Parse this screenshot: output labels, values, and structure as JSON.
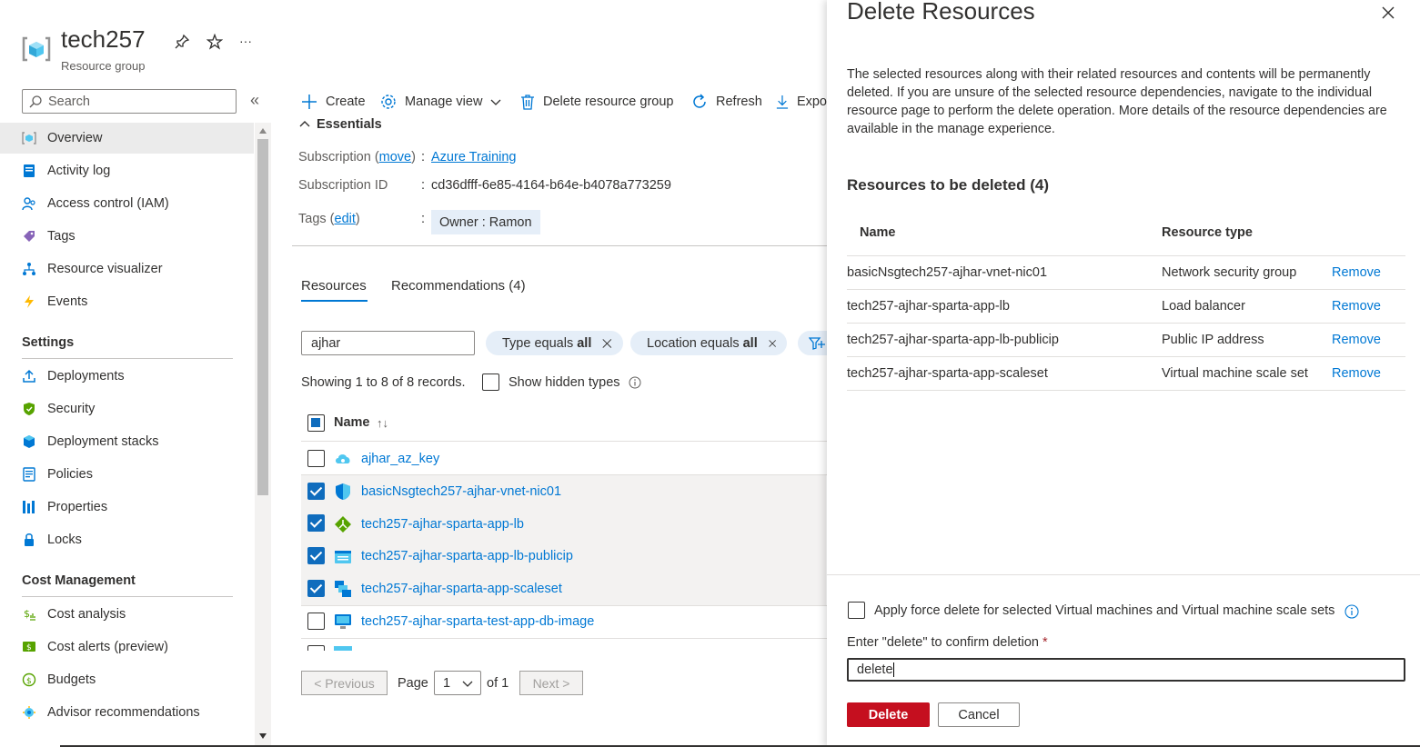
{
  "header": {
    "title": "tech257",
    "subtitle": "Resource group",
    "more": "···"
  },
  "search": {
    "placeholder": "Search",
    "collapse": "«"
  },
  "sidebar": {
    "items": [
      {
        "label": "Overview"
      },
      {
        "label": "Activity log"
      },
      {
        "label": "Access control (IAM)"
      },
      {
        "label": "Tags"
      },
      {
        "label": "Resource visualizer"
      },
      {
        "label": "Events"
      }
    ],
    "settings_title": "Settings",
    "settings": [
      {
        "label": "Deployments"
      },
      {
        "label": "Security"
      },
      {
        "label": "Deployment stacks"
      },
      {
        "label": "Policies"
      },
      {
        "label": "Properties"
      },
      {
        "label": "Locks"
      }
    ],
    "cost_title": "Cost Management",
    "cost": [
      {
        "label": "Cost analysis"
      },
      {
        "label": "Cost alerts (preview)"
      },
      {
        "label": "Budgets"
      },
      {
        "label": "Advisor recommendations"
      }
    ]
  },
  "toolbar": {
    "create": "Create",
    "manage_view": "Manage view",
    "delete_group": "Delete resource group",
    "refresh": "Refresh",
    "export": "Expo"
  },
  "essentials": {
    "title": "Essentials",
    "subscription_label": "Subscription (",
    "move": "move",
    "subscription_label_end": ")",
    "colon": ":",
    "subscription_value": "Azure Training",
    "subscription_id_label": "Subscription ID",
    "subscription_id_value": "cd36dfff-6e85-4164-b64e-b4078a773259",
    "tags_label": "Tags (",
    "edit": "edit",
    "tags_label_end": ")",
    "tag_value": "Owner : Ramon"
  },
  "tabs": {
    "resources": "Resources",
    "recommendations": "Recommendations (4)"
  },
  "filter": {
    "value": "ajhar",
    "type_pill": "Type equals ",
    "type_bold": "all",
    "location_pill": "Location equals ",
    "location_bold": "all"
  },
  "records": {
    "showing": "Showing 1 to 8 of 8 records.",
    "show_hidden": "Show hidden types"
  },
  "table": {
    "name_header": "Name",
    "sort_glyph": "↑↓",
    "rows": [
      {
        "name": "ajhar_az_key",
        "checked": false
      },
      {
        "name": "basicNsgtech257-ajhar-vnet-nic01",
        "checked": true
      },
      {
        "name": "tech257-ajhar-sparta-app-lb",
        "checked": true
      },
      {
        "name": "tech257-ajhar-sparta-app-lb-publicip",
        "checked": true
      },
      {
        "name": "tech257-ajhar-sparta-app-scaleset",
        "checked": true
      },
      {
        "name": "tech257-ajhar-sparta-test-app-db-image",
        "checked": false
      }
    ]
  },
  "pagination": {
    "previous": "< Previous",
    "page": "Page",
    "page_value": "1",
    "of": "of 1",
    "next": "Next >"
  },
  "panel": {
    "title": "Delete Resources",
    "close": "✕",
    "description": "The selected resources along with their related resources and contents will be permanently deleted. If you are unsure of the selected resource dependencies, navigate to the individual resource page to perform the delete operation. More details of the resource dependencies are available in the manage experience.",
    "list_title": "Resources to be deleted (4)",
    "col_name": "Name",
    "col_type": "Resource type",
    "rows": [
      {
        "name": "basicNsgtech257-ajhar-vnet-nic01",
        "type": "Network security group",
        "action": "Remove"
      },
      {
        "name": "tech257-ajhar-sparta-app-lb",
        "type": "Load balancer",
        "action": "Remove"
      },
      {
        "name": "tech257-ajhar-sparta-app-lb-publicip",
        "type": "Public IP address",
        "action": "Remove"
      },
      {
        "name": "tech257-ajhar-sparta-app-scaleset",
        "type": "Virtual machine scale set",
        "action": "Remove"
      }
    ],
    "force_delete": "Apply force delete for selected Virtual machines and Virtual machine scale sets",
    "confirm_label": "Enter \"delete\" to confirm deletion",
    "required": "*",
    "confirm_value": "delete",
    "delete_button": "Delete",
    "cancel_button": "Cancel"
  },
  "colors": {
    "accent": "#0078d4",
    "danger": "#c50f1f",
    "selected_row": "#f3f2f1"
  }
}
